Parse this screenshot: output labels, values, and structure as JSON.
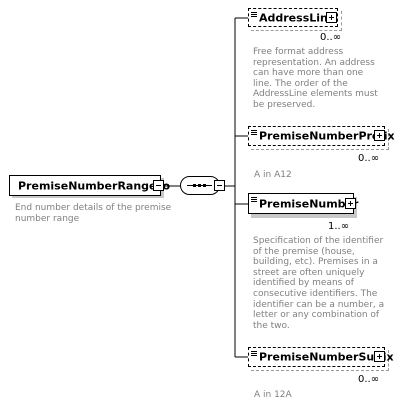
{
  "root": {
    "name": "PremiseNumberRangeTo",
    "doc": "End number details of the premise\nnumber range"
  },
  "children": [
    {
      "name": "AddressLine",
      "optional": true,
      "occurrence": "0..∞",
      "doc": "Free format address\nrepresentation. An address\ncan have more than one\nline. The order of the\nAddressLine elements must\nbe preserved."
    },
    {
      "name": "PremiseNumberPrefix",
      "optional": true,
      "occurrence": "0..∞",
      "doc": "A in A12"
    },
    {
      "name": "PremiseNumber",
      "optional": false,
      "occurrence": "1..∞",
      "doc": "Specification of the identifier\nof the premise (house,\nbuilding, etc). Premises in a\nstreet are often uniquely\nidentified by means of\nconsecutive identifiers. The\nidentifier can be a number, a\nletter or any combination of\nthe two."
    },
    {
      "name": "PremiseNumberSuffix",
      "optional": true,
      "occurrence": "0..∞",
      "doc": "A in 12A"
    }
  ]
}
